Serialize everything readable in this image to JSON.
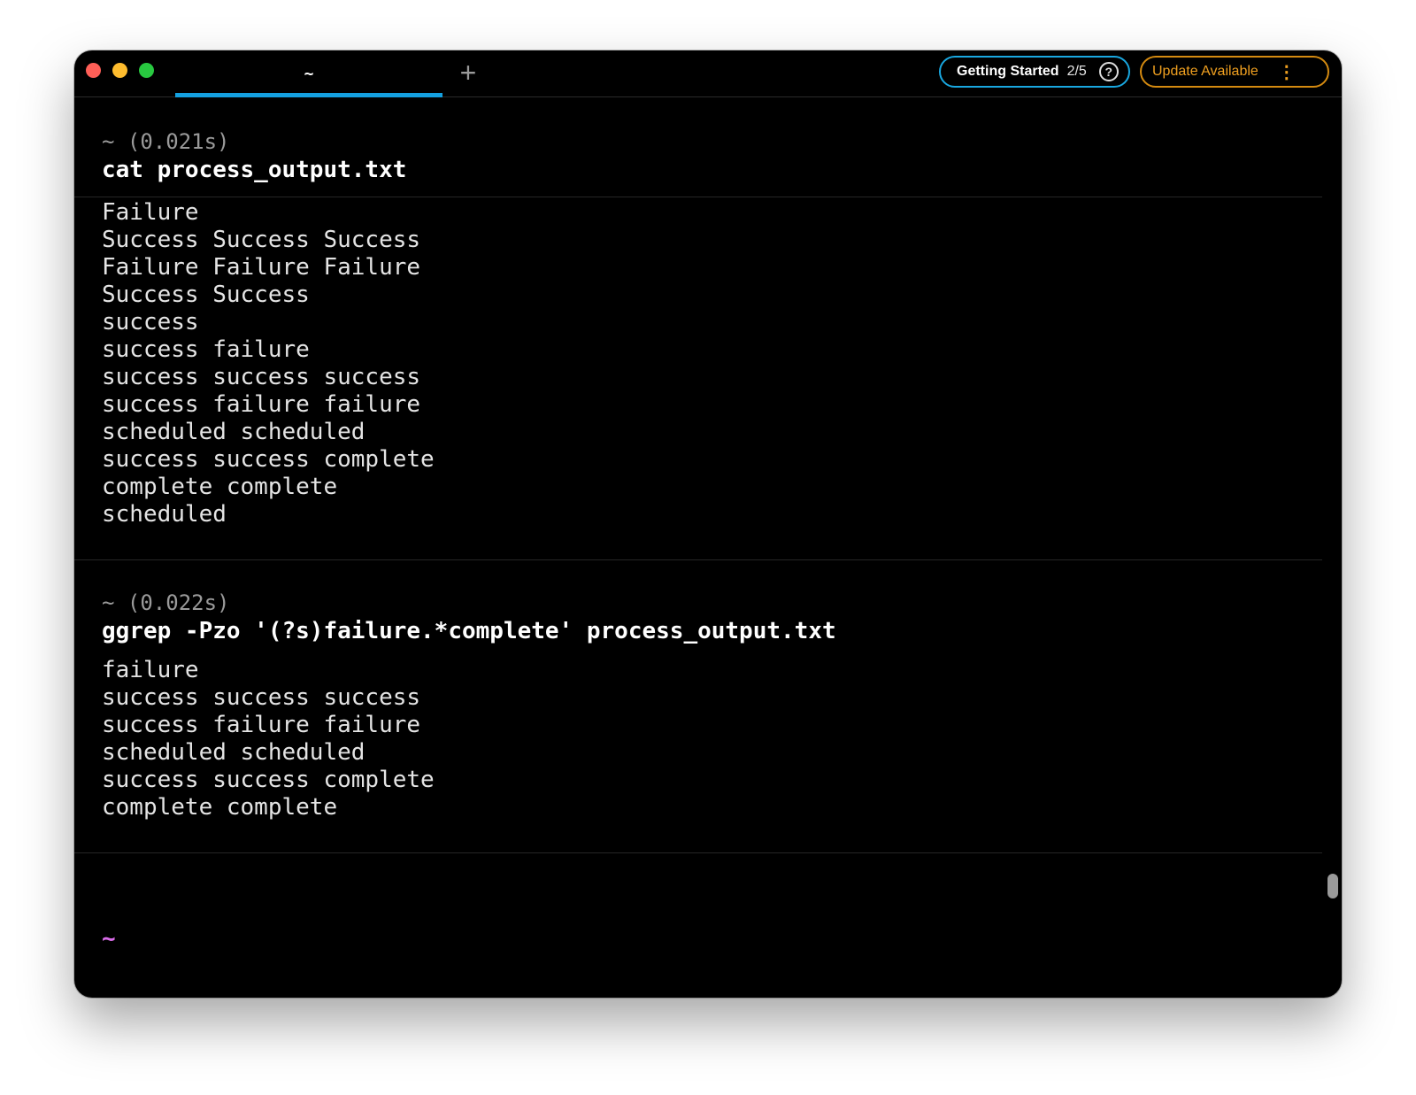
{
  "window": {
    "tab_label": "~",
    "new_tab_label": "+",
    "getting_started": {
      "label": "Getting Started",
      "progress": "2/5",
      "help_icon": "?"
    },
    "update": {
      "label": "Update Available",
      "menu_icon": "⋮"
    },
    "colors": {
      "accent": "#14a0e0",
      "update": "#f0a020",
      "prompt": "#d86be8"
    }
  },
  "blocks": [
    {
      "meta": "~ (0.021s)",
      "command": "cat process_output.txt",
      "output": [
        "Failure",
        "Success Success Success",
        "Failure Failure Failure",
        "Success Success",
        "success",
        "success failure",
        "success success success",
        "success failure failure",
        "scheduled scheduled",
        "success success complete",
        "complete complete",
        "scheduled"
      ]
    },
    {
      "meta": "~ (0.022s)",
      "command": "ggrep -Pzo '(?s)failure.*complete' process_output.txt",
      "output": [
        "failure",
        "success success success",
        "success failure failure",
        "scheduled scheduled",
        "success success complete",
        "complete complete"
      ]
    }
  ],
  "prompt": {
    "symbol": "~"
  }
}
